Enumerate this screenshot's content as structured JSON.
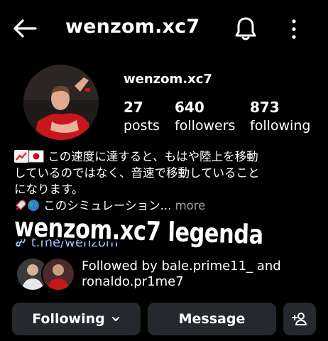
{
  "header": {
    "title": "wenzom.xc7",
    "back_icon": "arrow-left-icon",
    "notification_icon": "bell-icon",
    "menu_icon": "more-vertical-icon"
  },
  "profile": {
    "username": "wenzom.xc7",
    "stats": [
      {
        "value": "27",
        "label": "posts"
      },
      {
        "value": "640",
        "label": "followers"
      },
      {
        "value": "873",
        "label": "following"
      }
    ]
  },
  "bio": {
    "line1": "この速度に達すると、もはや陸上を移動",
    "line2": "しているのではなく、音速で移動していること",
    "line3": "になります。",
    "line4": "このシミュレーション",
    "ellipsis": "...",
    "more_label": "more",
    "line1_emojis": [
      "chart-increasing-icon",
      "japan-flag-icon"
    ],
    "line4_emojis": [
      "rocket-icon",
      "globe-icon"
    ]
  },
  "link": {
    "text": "t.me/wenzom",
    "icon": "link-icon"
  },
  "overlay_caption": "wenzom.xc7 legenda",
  "mutual": {
    "line1": "Followed by bale.prime11_ and",
    "line2": "ronaldo.pr1me7"
  },
  "actions": {
    "following_label": "Following",
    "message_label": "Message",
    "add_user_icon": "add-user-icon"
  },
  "colors": {
    "background": "#000000",
    "button_bg": "#25292e",
    "link": "#a6bfff",
    "muted": "#9aa0a6"
  }
}
